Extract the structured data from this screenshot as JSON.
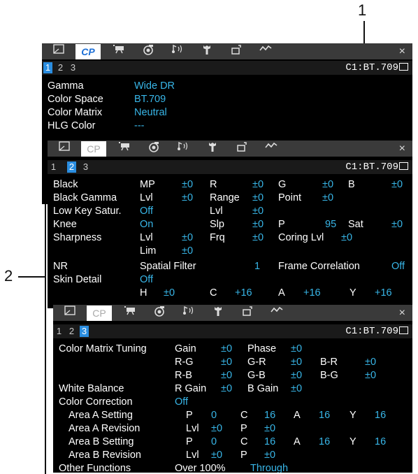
{
  "callouts": {
    "one": "1",
    "two": "2"
  },
  "tabs": {
    "cp": "CP",
    "close": "×"
  },
  "pages": [
    "1",
    "2",
    "3"
  ],
  "config": "C1:BT.709",
  "p1": {
    "gamma_l": "Gamma",
    "gamma_v": "Wide DR",
    "cs_l": "Color Space",
    "cs_v": "BT.709",
    "cm_l": "Color Matrix",
    "cm_v": "Neutral",
    "hlg_l": "HLG Color",
    "hlg_v": "---"
  },
  "p2": {
    "black": "Black",
    "mp": "MP",
    "pm0": "±0",
    "r": "R",
    "g": "G",
    "b": "B",
    "bg": "Black Gamma",
    "lvl": "Lvl",
    "range": "Range",
    "point": "Point",
    "lks": "Low Key Satur.",
    "off": "Off",
    "knee": "Knee",
    "on": "On",
    "slp": "Slp",
    "p": "P",
    "v95": "95",
    "sat": "Sat",
    "sharp": "Sharpness",
    "frq": "Frq",
    "coring": "Coring Lvl",
    "lim": "Lim",
    "nr": "NR",
    "spatial": "Spatial Filter",
    "one": "1",
    "frame": "Frame Correlation",
    "skin": "Skin Detail",
    "h": "H",
    "c": "C",
    "a": "A",
    "y": "Y",
    "p16": "+16"
  },
  "p3": {
    "cmt": "Color Matrix Tuning",
    "gain": "Gain",
    "phase": "Phase",
    "pm0": "±0",
    "rg": "R-G",
    "gr": "G-R",
    "br": "B-R",
    "rb": "R-B",
    "gb": "G-B",
    "bgc": "B-G",
    "wb": "White Balance",
    "rgain": "R Gain",
    "bgain": "B Gain",
    "cc": "Color Correction",
    "off": "Off",
    "aas": "Area A Setting",
    "aar": "Area A Revision",
    "abs": "Area B Setting",
    "abr": "Area B Revision",
    "p": "P",
    "zero": "0",
    "c": "C",
    "v16": "16",
    "a": "A",
    "y": "Y",
    "lvl": "Lvl",
    "other": "Other Functions",
    "over": "Over 100%",
    "through": "Through"
  }
}
